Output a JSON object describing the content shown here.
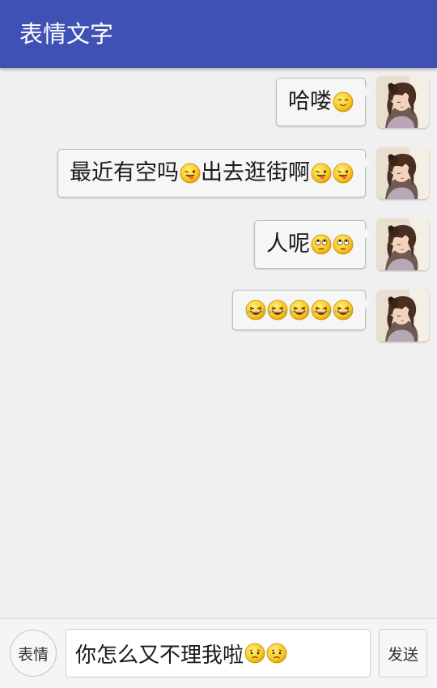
{
  "app_bar": {
    "title": "表情文字",
    "color": "#3f51b5"
  },
  "messages": [
    {
      "text": "哈喽",
      "emojis": [
        "smile-emoji"
      ],
      "sender": "me"
    },
    {
      "text": "最近有空吗",
      "emojis": [
        "tongue-wink-emoji"
      ],
      "text2": "出去逛街啊",
      "emojis2": [
        "tongue-wink-emoji",
        "tongue-wink-emoji"
      ],
      "sender": "me"
    },
    {
      "text": "人呢",
      "emojis": [
        "eyeroll-emoji",
        "eyeroll-emoji"
      ],
      "sender": "me"
    },
    {
      "text": "",
      "emojis": [
        "laugh-tears-emoji",
        "laugh-tears-emoji",
        "laugh-tears-emoji",
        "laugh-tears-emoji",
        "laugh-tears-emoji"
      ],
      "sender": "me"
    }
  ],
  "composer": {
    "emoji_button_label": "表情",
    "input_value": "你怎么又不理我啦",
    "input_emojis": [
      "sad-emoji",
      "sad-emoji"
    ],
    "send_label": "发送"
  },
  "avatar_icon": "girl-photo-avatar"
}
